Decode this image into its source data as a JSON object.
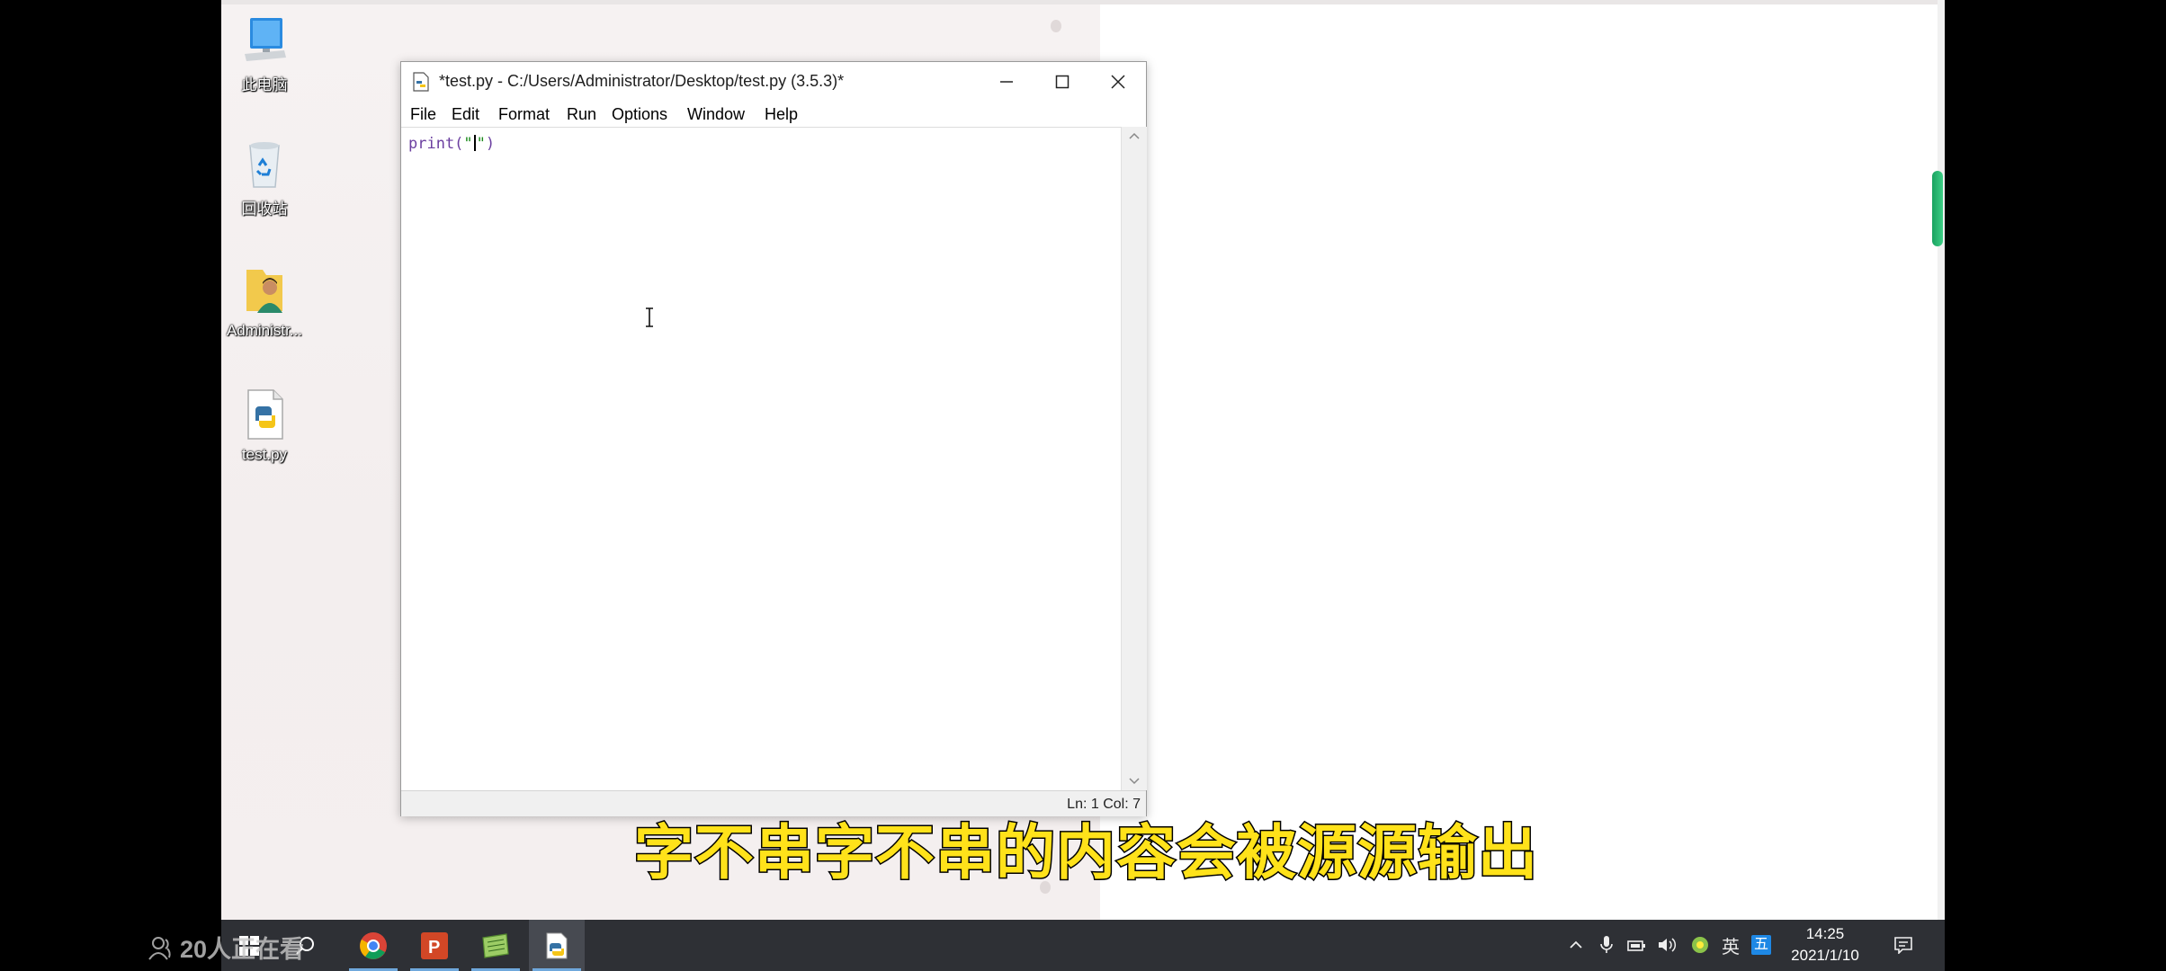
{
  "desktop": {
    "icons": [
      {
        "label": "此电脑",
        "icon": "computer-icon"
      },
      {
        "label": "回收站",
        "icon": "recycle-bin-icon"
      },
      {
        "label": "Administr...",
        "icon": "user-folder-icon"
      },
      {
        "label": "test.py",
        "icon": "python-file-icon"
      }
    ]
  },
  "idle_window": {
    "title": "*test.py - C:/Users/Administrator/Desktop/test.py (3.5.3)*",
    "menu": [
      "File",
      "Edit",
      "Format",
      "Run",
      "Options",
      "Window",
      "Help"
    ],
    "code": {
      "prefix": "print(",
      "string_open": "\"",
      "string_close": "\"",
      "suffix": ")"
    },
    "status": "Ln: 1   Col: 7"
  },
  "taskbar": {
    "apps": [
      "windows-start-icon",
      "search-icon",
      "chrome-icon",
      "powerpoint-icon",
      "notepad-icon",
      "python-idle-icon"
    ],
    "tray": {
      "ime_label": "英",
      "ime_mode": "五",
      "time": "14:25",
      "date": "2021/1/10"
    }
  },
  "overlay": {
    "viewer_text": "20人正在看",
    "subtitle": "字不串字不串的内容会被源源输出"
  },
  "colors": {
    "taskbar": "#2e3035",
    "subtitle": "#ffe21a",
    "code_builtin": "#6b3fa0",
    "code_string": "#1a8a1a"
  }
}
